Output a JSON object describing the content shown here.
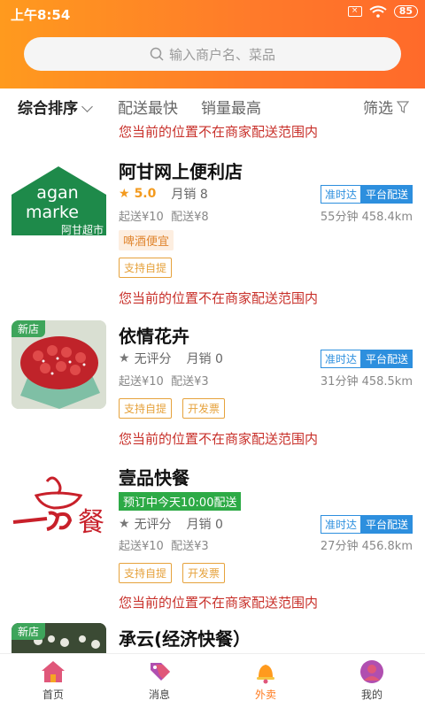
{
  "status": {
    "time": "上午8:54",
    "battery": "85"
  },
  "search": {
    "placeholder": "输入商户名、菜品"
  },
  "filters": {
    "sort": "综合排序",
    "fast": "配送最快",
    "sales": "销量最高",
    "screen": "筛选"
  },
  "notices": {
    "out_of_range": "您当前的位置不在商家配送范围内"
  },
  "stores": [
    {
      "name": "阿甘网上便利店",
      "logo_text_1": "agan",
      "logo_text_2": "marke",
      "logo_text_3": "阿甘超市",
      "rating": "5.0",
      "monthly_sales": "月销 8",
      "min_order": "起送¥10",
      "delivery_fee": "配送¥8",
      "time_distance": "55分钟 458.4km",
      "tag_ontime": "准时达",
      "tag_platform": "平台配送",
      "promo": "啤酒便宜",
      "chip1": "支持自提"
    },
    {
      "name": "依情花卉",
      "badge": "新店",
      "rating": "无评分",
      "monthly_sales": "月销 0",
      "min_order": "起送¥10",
      "delivery_fee": "配送¥3",
      "time_distance": "31分钟 458.5km",
      "tag_ontime": "准时达",
      "tag_platform": "平台配送",
      "chip1": "支持自提",
      "chip2": "开发票"
    },
    {
      "name": "壹品快餐",
      "logo_char": "餐",
      "preorder": "预订中今天10:00配送",
      "rating": "无评分",
      "monthly_sales": "月销 0",
      "min_order": "起送¥10",
      "delivery_fee": "配送¥3",
      "time_distance": "27分钟 456.8km",
      "tag_ontime": "准时达",
      "tag_platform": "平台配送",
      "chip1": "支持自提",
      "chip2": "开发票"
    },
    {
      "name": "承云(经济快餐）",
      "badge": "新店"
    }
  ],
  "nav": {
    "home": "首页",
    "messages": "消息",
    "takeout": "外卖",
    "mine": "我的"
  },
  "colors": {
    "accent": "#ff7a1e",
    "notice_red": "#c8302a",
    "blue_tag": "#2d8fde",
    "green": "#3ea55b"
  }
}
